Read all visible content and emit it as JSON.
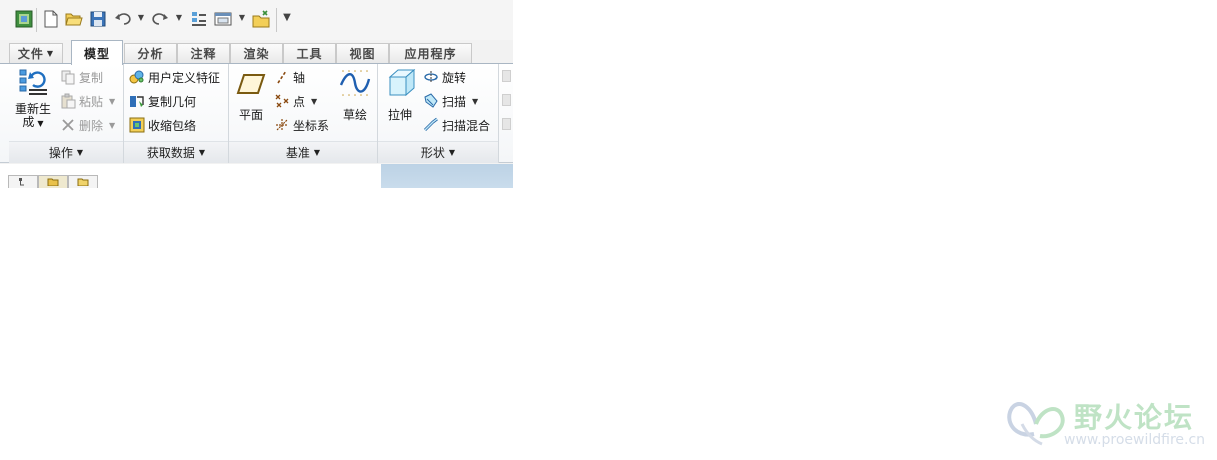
{
  "ribbon": {
    "tabs": [
      {
        "label": "文件",
        "has_dropdown": true
      },
      {
        "label": "模型",
        "active": true
      },
      {
        "label": "分析"
      },
      {
        "label": "注释"
      },
      {
        "label": "渲染"
      },
      {
        "label": "工具"
      },
      {
        "label": "视图"
      },
      {
        "label": "应用程序"
      }
    ],
    "groups": {
      "operations": {
        "label": "操作",
        "regenerate": "重新生成",
        "regenerate_l1": "重新生",
        "regenerate_l2": "成",
        "copy": "复制",
        "paste": "粘贴",
        "delete": "删除"
      },
      "get_data": {
        "label": "获取数据",
        "user_defined_feature": "用户定义特征",
        "copy_geometry": "复制几何",
        "shrinkwrap": "收缩包络"
      },
      "datum": {
        "label": "基准",
        "plane": "平面",
        "axis": "轴",
        "point": "点",
        "coord_system": "坐标系",
        "sketch": "草绘"
      },
      "shapes": {
        "label": "形状",
        "extrude": "拉伸",
        "revolve": "旋转",
        "sweep": "扫描",
        "swept_blend": "扫描混合"
      }
    }
  },
  "colors": {
    "accent": "#a9b6c3",
    "graphics_bg": "#c3d7ea",
    "watermark_green": "#bfe3c5"
  },
  "watermark": {
    "title": "野火论坛",
    "url": "www.proewildfire.cn"
  }
}
